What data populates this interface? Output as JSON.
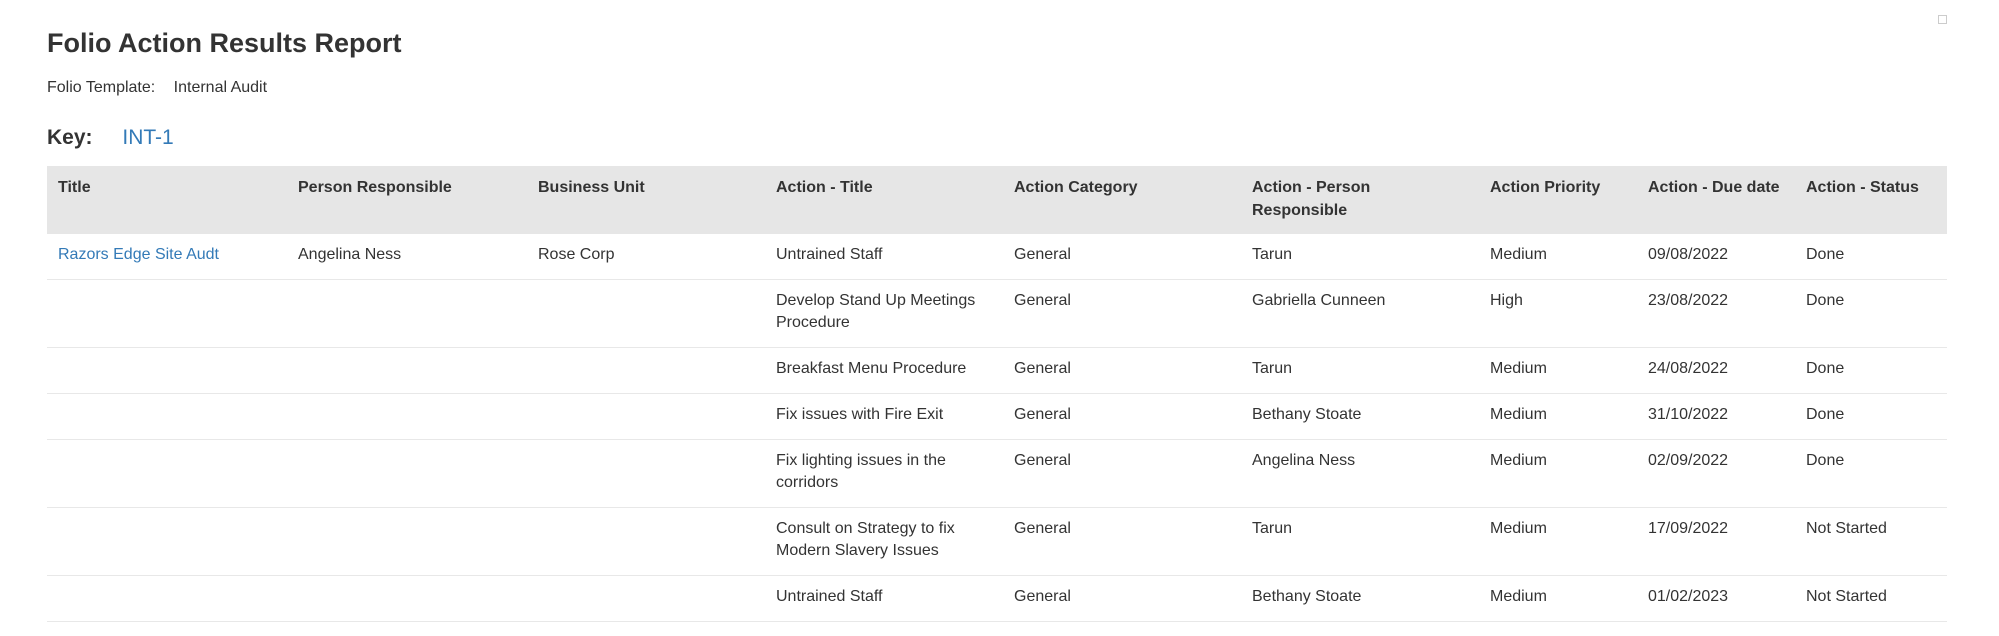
{
  "report": {
    "title": "Folio Action Results Report",
    "template_label": "Folio Template:",
    "template_value": "Internal Audit",
    "key_label": "Key:",
    "key_value": "INT-1"
  },
  "table": {
    "headers": {
      "title": "Title",
      "person": "Person Responsible",
      "unit": "Business Unit",
      "action_title": "Action - Title",
      "category": "Action Category",
      "action_person": "Action - Person Responsible",
      "priority": "Action Priority",
      "due": "Action - Due date",
      "status": "Action - Status"
    },
    "rows": [
      {
        "title": "Razors Edge Site Audt",
        "person": "Angelina Ness",
        "unit": "Rose Corp",
        "action_title": "Untrained Staff",
        "category": "General",
        "action_person": "Tarun",
        "priority": "Medium",
        "due": "09/08/2022",
        "status": "Done"
      },
      {
        "title": "",
        "person": "",
        "unit": "",
        "action_title": "Develop Stand Up Meetings Procedure",
        "category": "General",
        "action_person": "Gabriella Cunneen",
        "priority": "High",
        "due": "23/08/2022",
        "status": "Done"
      },
      {
        "title": "",
        "person": "",
        "unit": "",
        "action_title": "Breakfast Menu Procedure",
        "category": "General",
        "action_person": "Tarun",
        "priority": "Medium",
        "due": "24/08/2022",
        "status": "Done"
      },
      {
        "title": "",
        "person": "",
        "unit": "",
        "action_title": "Fix issues with Fire Exit",
        "category": "General",
        "action_person": "Bethany Stoate",
        "priority": "Medium",
        "due": "31/10/2022",
        "status": "Done"
      },
      {
        "title": "",
        "person": "",
        "unit": "",
        "action_title": "Fix lighting issues in the corridors",
        "category": "General",
        "action_person": "Angelina Ness",
        "priority": "Medium",
        "due": "02/09/2022",
        "status": "Done"
      },
      {
        "title": "",
        "person": "",
        "unit": "",
        "action_title": "Consult on Strategy to fix Modern Slavery Issues",
        "category": "General",
        "action_person": "Tarun",
        "priority": "Medium",
        "due": "17/09/2022",
        "status": "Not Started"
      },
      {
        "title": "",
        "person": "",
        "unit": "",
        "action_title": "Untrained Staff",
        "category": "General",
        "action_person": "Bethany Stoate",
        "priority": "Medium",
        "due": "01/02/2023",
        "status": "Not Started"
      }
    ]
  },
  "colors": {
    "link": "#337ab7",
    "priority_medium": "#f0743c",
    "priority_high": "#e8101a",
    "status_done": "#6cd28a",
    "status_not_started": "#d20e1a",
    "header_bg": "#e6e6e6"
  }
}
